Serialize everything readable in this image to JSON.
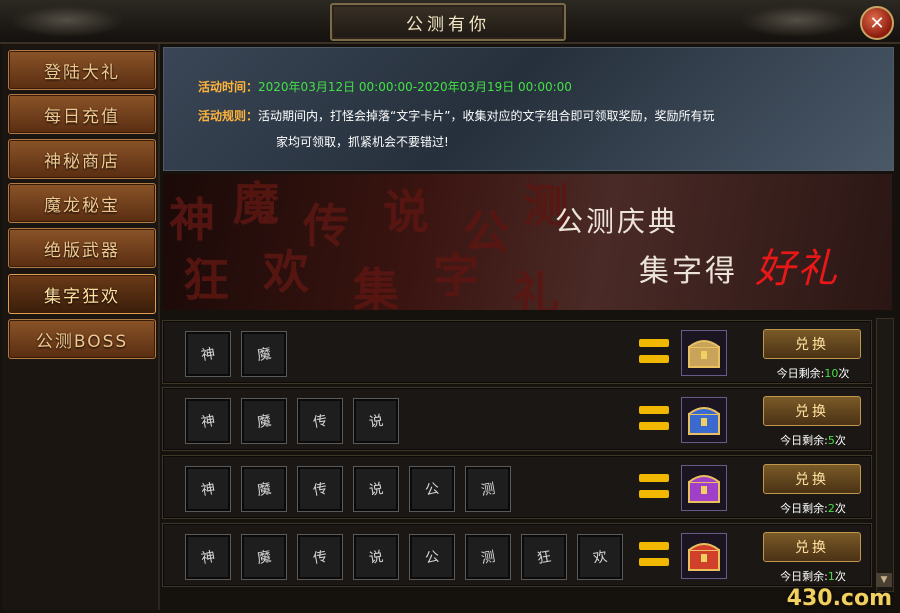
{
  "window": {
    "title": "公测有你",
    "close_label": "✕"
  },
  "sidebar": {
    "items": [
      {
        "label": "登陆大礼"
      },
      {
        "label": "每日充值"
      },
      {
        "label": "神秘商店"
      },
      {
        "label": "魔龙秘宝"
      },
      {
        "label": "绝版武器"
      },
      {
        "label": "集字狂欢",
        "active": true
      },
      {
        "label": "公测BOSS"
      }
    ]
  },
  "info": {
    "time_label": "活动时间：",
    "time_value": "2020年03月12日 00:00:00-2020年03月19日 00:00:00",
    "rule_label": "活动规则：",
    "rule_line1": "活动期间内，打怪会掉落“文字卡片”，收集对应的文字组合即可领取奖励，奖励所有玩",
    "rule_line2": "家均可领取，抓紧机会不要错过!"
  },
  "banner": {
    "line1": "公测庆典",
    "line2": "集字得",
    "line3": "好礼"
  },
  "exchange": {
    "button_label": "兑换",
    "rows": [
      {
        "cards": [
          "神",
          "魔"
        ],
        "remain_prefix": "今日剩余:",
        "remain_count": "10",
        "remain_suffix": "次",
        "chest_color": "#c9a35a"
      },
      {
        "cards": [
          "神",
          "魔",
          "传",
          "说"
        ],
        "remain_prefix": "今日剩余:",
        "remain_count": "5",
        "remain_suffix": "次",
        "chest_color": "#3a6ad0"
      },
      {
        "cards": [
          "神",
          "魔",
          "传",
          "说",
          "公",
          "测"
        ],
        "remain_prefix": "今日剩余:",
        "remain_count": "2",
        "remain_suffix": "次",
        "chest_color": "#a040c8"
      },
      {
        "cards": [
          "神",
          "魔",
          "传",
          "说",
          "公",
          "测",
          "狂",
          "欢"
        ],
        "remain_prefix": "今日剩余:",
        "remain_count": "1",
        "remain_suffix": "次",
        "chest_color": "#d0402a"
      }
    ]
  },
  "watermark": "430.com"
}
